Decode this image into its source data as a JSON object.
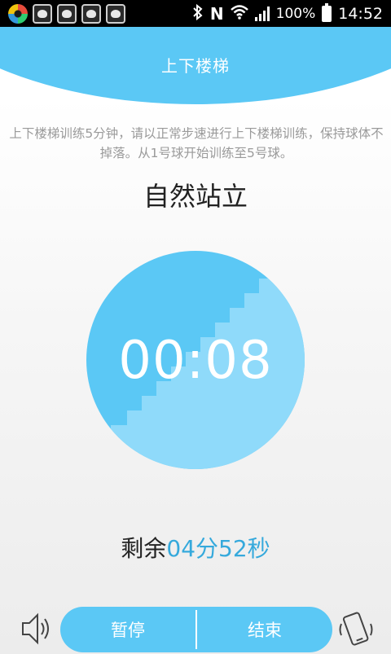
{
  "status_bar": {
    "battery": "100%",
    "time": "14:52",
    "network_letter": "N"
  },
  "header": {
    "title": "上下楼梯"
  },
  "instructions": "上下楼梯训练5分钟，请以正常步速进行上下楼梯训练，保持球体不掉落。从1号球开始训练至5号球。",
  "pose_label": "自然站立",
  "timer": {
    "elapsed": "00:08"
  },
  "remaining": {
    "prefix": "剩余",
    "value": "04分52秒"
  },
  "controls": {
    "pause_label": "暂停",
    "end_label": "结束"
  },
  "colors": {
    "accent": "#5bc8f5",
    "circle_dark": "#5bc8f5",
    "circle_light": "#8fdafa",
    "remaining_value": "#35a9dc"
  }
}
